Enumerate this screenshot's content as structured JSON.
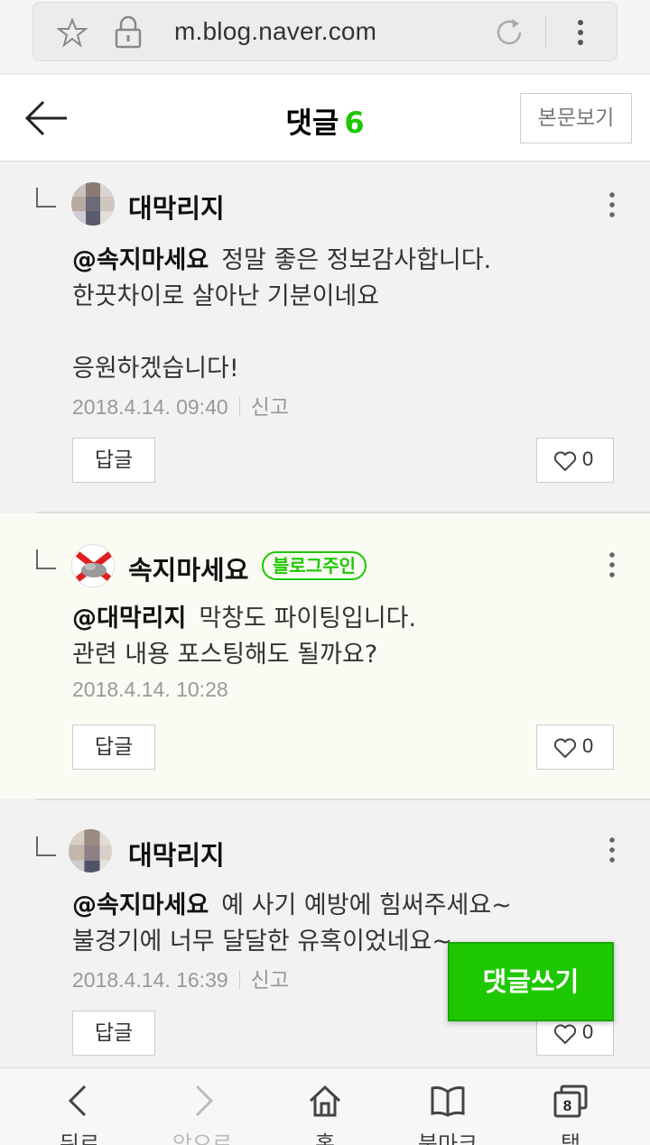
{
  "browser": {
    "url": "m.blog.naver.com"
  },
  "header": {
    "title": "댓글",
    "count": "6",
    "view_post_label": "본문보기"
  },
  "comments": [
    {
      "author": "대막리지",
      "mention": "@속지마세요",
      "lines": [
        "정말 좋은 정보감사합니다.",
        "한끗차이로 살아난 기분이네요",
        "",
        "응원하겠습니다!"
      ],
      "date": "2018.4.14. 09:40",
      "report": "신고",
      "reply_label": "답글",
      "likes": "0"
    },
    {
      "author": "속지마세요",
      "badge": "블로그주인",
      "mention": "@대막리지",
      "lines": [
        "막창도 파이팅입니다.",
        "관련 내용 포스팅해도 될까요?"
      ],
      "date": "2018.4.14. 10:28",
      "reply_label": "답글",
      "likes": "0"
    },
    {
      "author": "대막리지",
      "mention": "@속지마세요",
      "lines": [
        "예 사기 예방에 힘써주세요~",
        "불경기에 너무 달달한 유혹이었네요~"
      ],
      "date": "2018.4.14. 16:39",
      "report": "신고",
      "reply_label": "답글",
      "likes": "0"
    }
  ],
  "write_button": "댓글쓰기",
  "bottom_nav": [
    {
      "label": "뒤로",
      "icon": "back-icon",
      "enabled": true
    },
    {
      "label": "앞으로",
      "icon": "forward-icon",
      "enabled": false
    },
    {
      "label": "홈",
      "icon": "home-icon",
      "enabled": true
    },
    {
      "label": "북마크",
      "icon": "bookmark-icon",
      "enabled": true
    },
    {
      "label": "탭",
      "icon": "tabs-icon",
      "enabled": true,
      "badge": "8"
    }
  ],
  "colors": {
    "accent": "#1ec800",
    "meta_text": "#999999",
    "owner_bg": "#fafcf4"
  }
}
